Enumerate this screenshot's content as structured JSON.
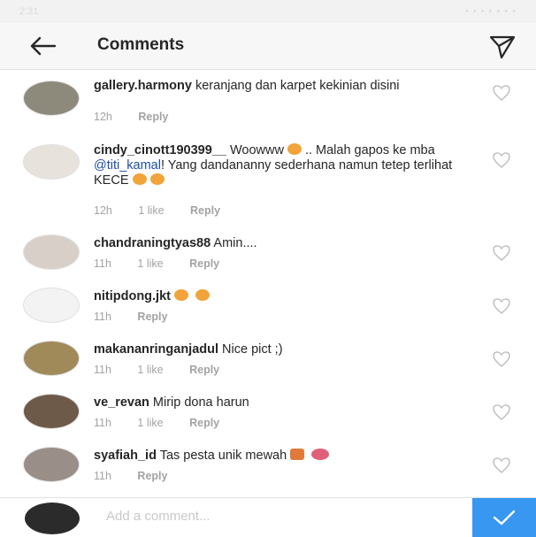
{
  "statusbar": {
    "time": "2:31",
    "system": "• • •  •  •  •  •"
  },
  "header": {
    "title": "Comments",
    "back_icon": "arrow-left-icon",
    "send_icon": "paper-plane-icon"
  },
  "comments": [
    {
      "user": "gallery.harmony",
      "text": "keranjang dan karpet kekinian disini",
      "time": "12h",
      "likes": "",
      "reply": "Reply"
    },
    {
      "user": "cindy_cinott190399__",
      "text_a": "Woowww",
      "text_b": ".. Malah gapos ke mba",
      "mention": "@titi_kamal",
      "text_c": "! Yang dandananny sederhana namun tetep terlihat KECE",
      "time": "12h",
      "likes": "1 like",
      "reply": "Reply"
    },
    {
      "user": "chandraningtyas88",
      "text": "Amin....",
      "time": "11h",
      "likes": "1 like",
      "reply": "Reply"
    },
    {
      "user": "nitipdong.jkt",
      "text": "",
      "time": "11h",
      "likes": "",
      "reply": "Reply"
    },
    {
      "user": "makananringanjadul",
      "text": "Nice pict ;)",
      "time": "11h",
      "likes": "1 like",
      "reply": "Reply"
    },
    {
      "user": "ve_revan",
      "text": "Mirip dona harun",
      "time": "11h",
      "likes": "1 like",
      "reply": "Reply"
    },
    {
      "user": "syafiah_id",
      "text": "Tas pesta unik mewah",
      "time": "11h",
      "likes": "",
      "reply": "Reply"
    }
  ],
  "composer": {
    "placeholder": "Add a comment...",
    "post_icon": "checkmark-icon"
  },
  "colors": {
    "accent": "#3897f0",
    "mention": "#1c4fa8",
    "meta": "#a3a3a3",
    "header_bg": "#f7f7f7"
  }
}
